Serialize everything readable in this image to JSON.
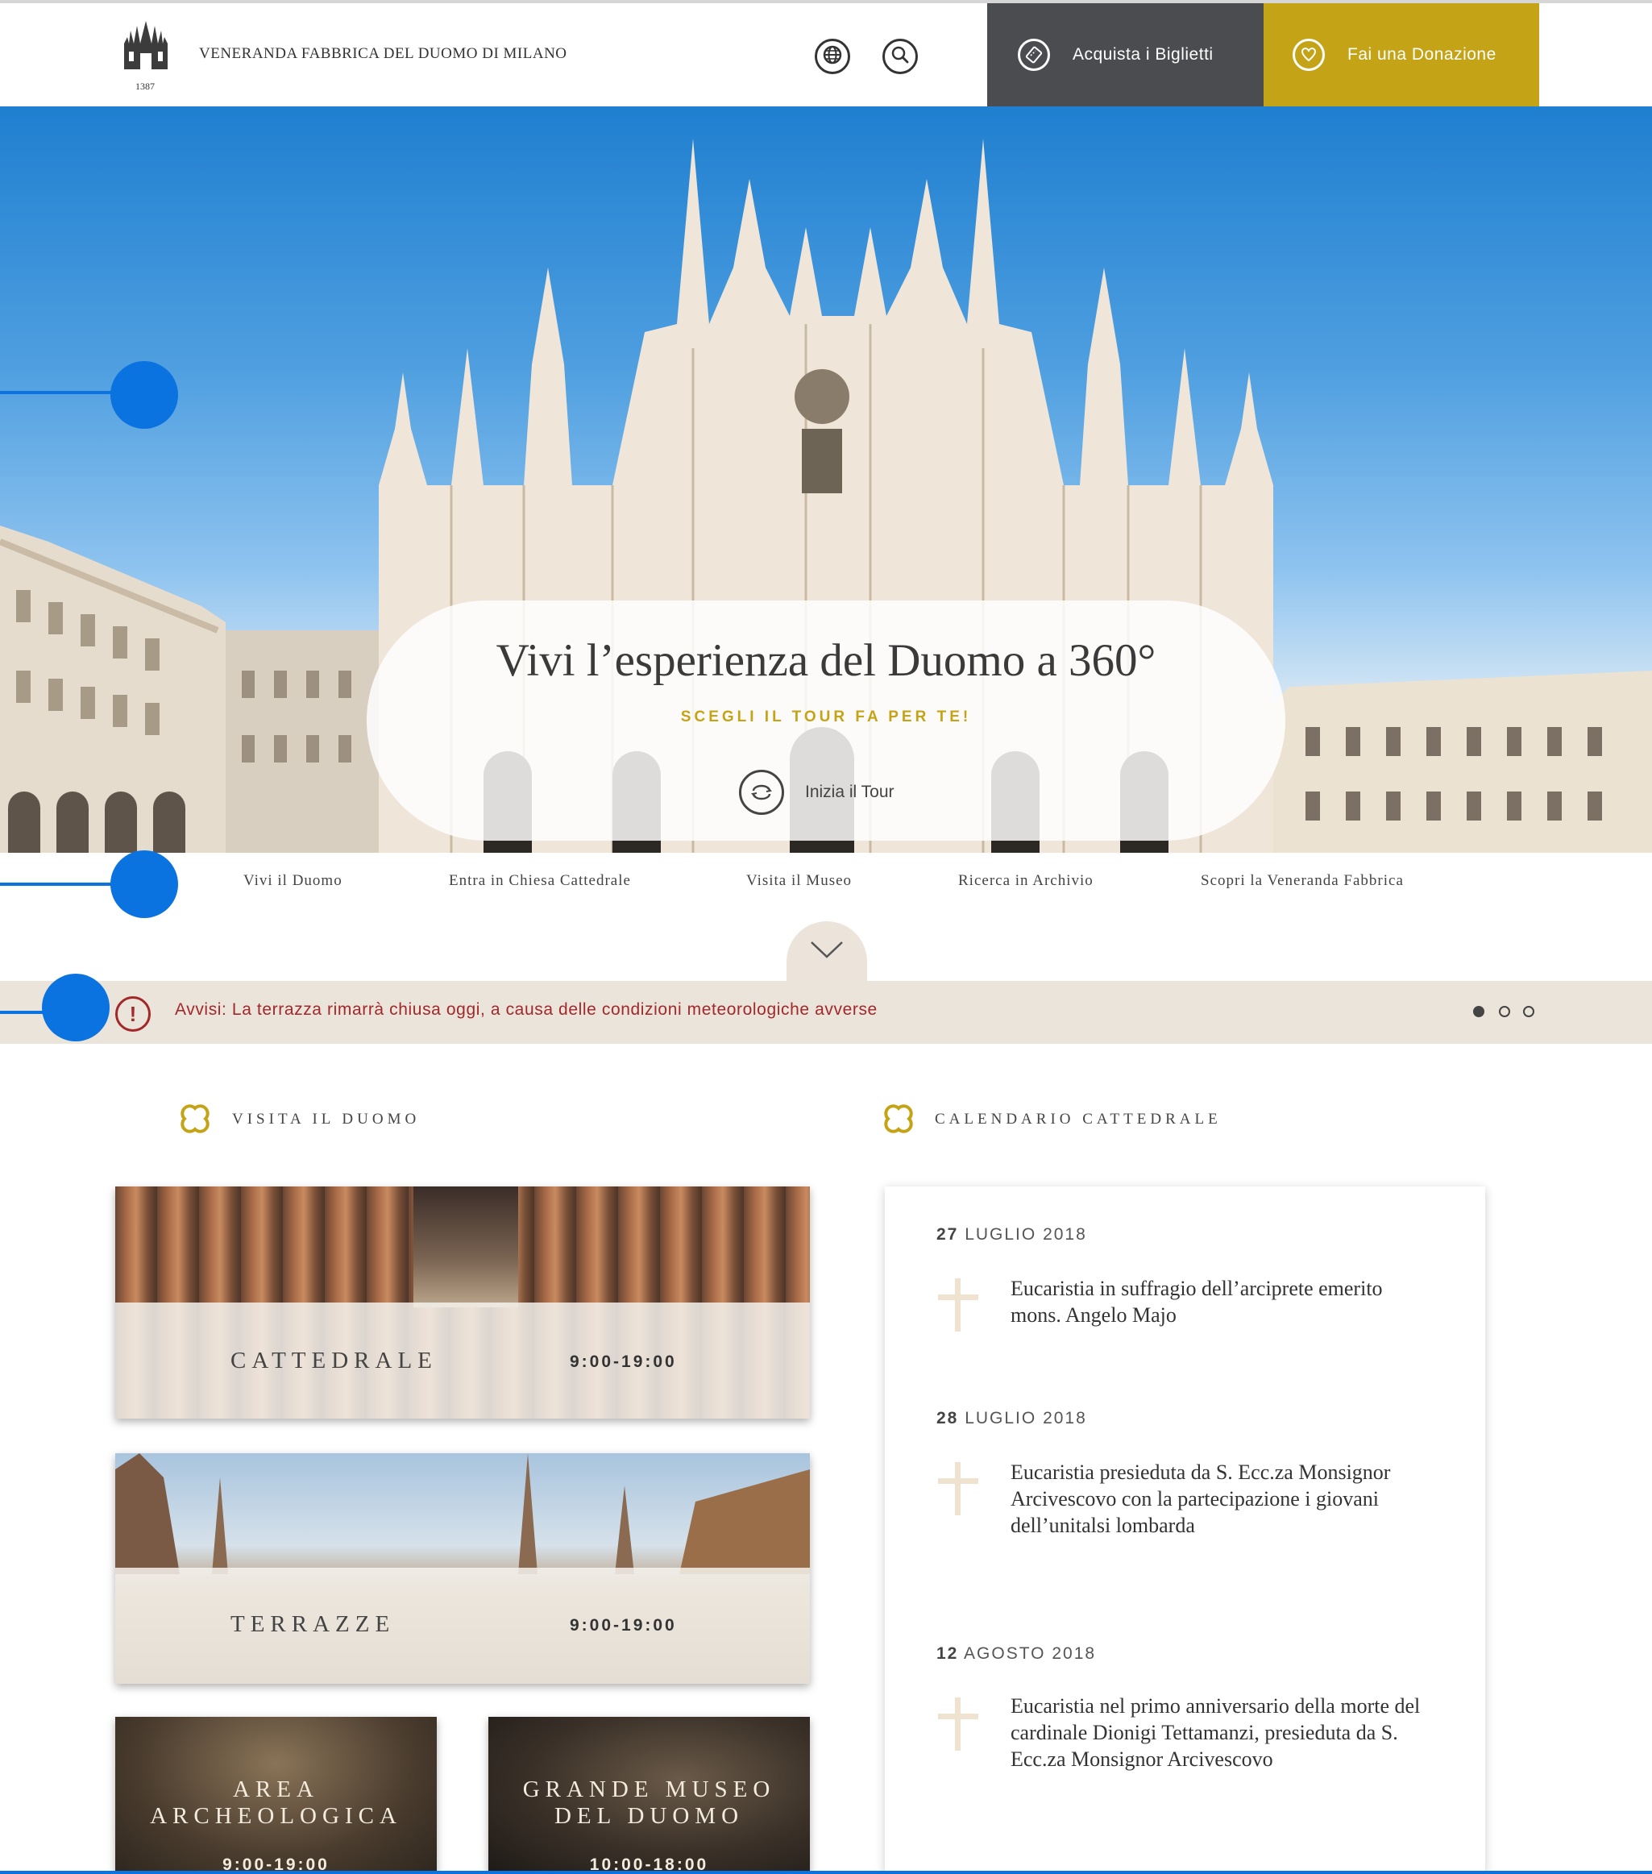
{
  "header": {
    "logo_year": "1387",
    "brand": "VENERANDA FABBRICA DEL DUOMO DI MILANO",
    "globe_icon": "globe-icon",
    "search_icon": "search-icon",
    "tickets_label": "Acquista i Biglietti",
    "tickets_icon": "ticket-icon",
    "donate_label": "Fai una Donazione",
    "donate_icon": "heart-icon"
  },
  "hero": {
    "title": "Vivi l’esperienza del Duomo a 360°",
    "subtitle": "SCEGLI IL TOUR FA PER TE!",
    "start_label": "Inizia il Tour",
    "start_icon": "360-rotate-icon"
  },
  "nav": {
    "items": [
      {
        "label": "Vivi il Duomo"
      },
      {
        "label": "Entra in Chiesa Cattedrale"
      },
      {
        "label": "Visita il Museo"
      },
      {
        "label": "Ricerca in Archivio"
      },
      {
        "label": "Scopri la Veneranda Fabbrica"
      }
    ],
    "scroll_icon": "chevron-down-icon"
  },
  "alert": {
    "icon": "exclamation-icon",
    "text": "Avvisi: La terrazza rimarrà chiusa oggi, a causa delle condizioni meteorologiche avverse",
    "active_slide": 1,
    "slide_count": 3
  },
  "visit": {
    "heading": "VISITA IL DUOMO",
    "cards": [
      {
        "name": "CATTEDRALE",
        "hours": "9:00-19:00"
      },
      {
        "name": "TERRAZZE",
        "hours": "9:00-19:00"
      },
      {
        "name_line1": "AREA",
        "name_line2": "ARCHEOLOGICA",
        "hours": "9:00-19:00"
      },
      {
        "name_line1": "GRANDE MUSEO",
        "name_line2": "DEL DUOMO",
        "hours": "10:00-18:00"
      }
    ]
  },
  "calendar": {
    "heading": "CALENDARIO CATTEDRALE",
    "events": [
      {
        "day": "27",
        "month_year": "LUGLIO 2018",
        "title": "Eucaristia in suffragio dell’arciprete emerito mons. Angelo Majo"
      },
      {
        "day": "28",
        "month_year": "LUGLIO 2018",
        "title": "Eucaristia presieduta da S. Ecc.za Monsignor Arcivescovo con la partecipazione i giovani dell’unitalsi lombarda"
      },
      {
        "day": "12",
        "month_year": "AGOSTO 2018",
        "title": "Eucaristia nel primo anniversario della morte del cardinale Dionigi Tettamanzi, presieduta da S. Ecc.za Monsignor Arcivescovo"
      }
    ]
  },
  "colors": {
    "accent_gold": "#c5a316",
    "dark_button": "#4a4c50",
    "alert_red": "#a2282a",
    "alert_bg": "#ebe4db",
    "annotation_blue": "#0a73e0"
  }
}
